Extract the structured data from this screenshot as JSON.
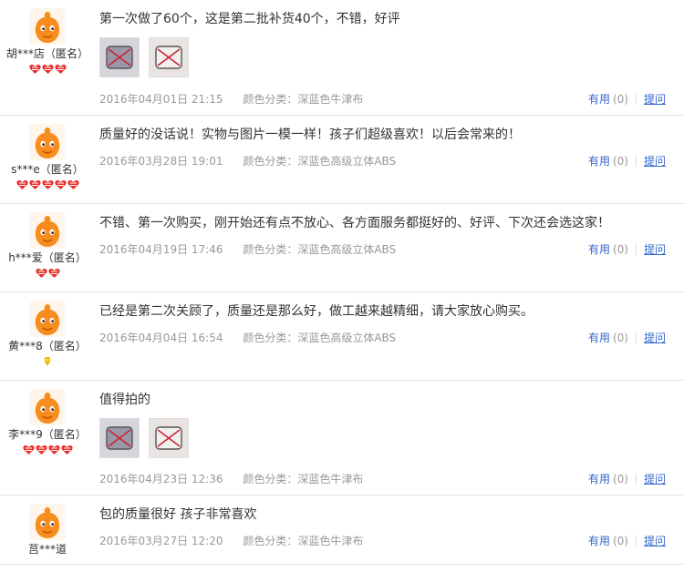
{
  "labels": {
    "color_prefix": "颜色分类：",
    "useful": "有用",
    "ask": "提问"
  },
  "colors": {
    "accent": "#3366cc",
    "meta": "#999999",
    "heart": "#e8302e",
    "diamond": "#f4b400"
  },
  "reviews": [
    {
      "user": "胡***店（匿名）",
      "rank": [
        "heart",
        "heart",
        "heart"
      ],
      "text": "第一次做了60个，这是第二批补货40个，不错，好评",
      "pics": 2,
      "date": "2016年04月01日 21:15",
      "color": "深蓝色牛津布",
      "useful_count": "(0)"
    },
    {
      "user": "s***e（匿名）",
      "rank": [
        "heart",
        "heart",
        "heart",
        "heart",
        "heart"
      ],
      "text": "质量好的没话说！实物与图片一模一样！孩子们超级喜欢！以后会常来的！",
      "pics": 0,
      "date": "2016年03月28日 19:01",
      "color": "深蓝色高级立体ABS",
      "useful_count": "(0)"
    },
    {
      "user": "h***爱（匿名）",
      "rank": [
        "heart",
        "heart"
      ],
      "text": "不错、第一次购买，刚开始还有点不放心、各方面服务都挺好的、好评、下次还会选这家！",
      "pics": 0,
      "date": "2016年04月19日 17:46",
      "color": "深蓝色高级立体ABS",
      "useful_count": "(0)"
    },
    {
      "user": "黄***8（匿名）",
      "rank": [
        "diamond"
      ],
      "text": "已经是第二次关顾了，质量还是那么好，做工越来越精细，请大家放心购买。",
      "pics": 0,
      "date": "2016年04月04日 16:54",
      "color": "深蓝色高级立体ABS",
      "useful_count": "(0)"
    },
    {
      "user": "李***9（匿名）",
      "rank": [
        "heart",
        "heart",
        "heart",
        "heart"
      ],
      "text": "值得拍的",
      "pics": 2,
      "date": "2016年04月23日 12:36",
      "color": "深蓝色牛津布",
      "useful_count": "(0)"
    },
    {
      "user": "莒***道",
      "rank": [],
      "text": "包的质量很好 孩子非常喜欢",
      "pics": 0,
      "date": "2016年03月27日 12:20",
      "color": "深蓝色牛津布",
      "useful_count": "(0)"
    }
  ]
}
